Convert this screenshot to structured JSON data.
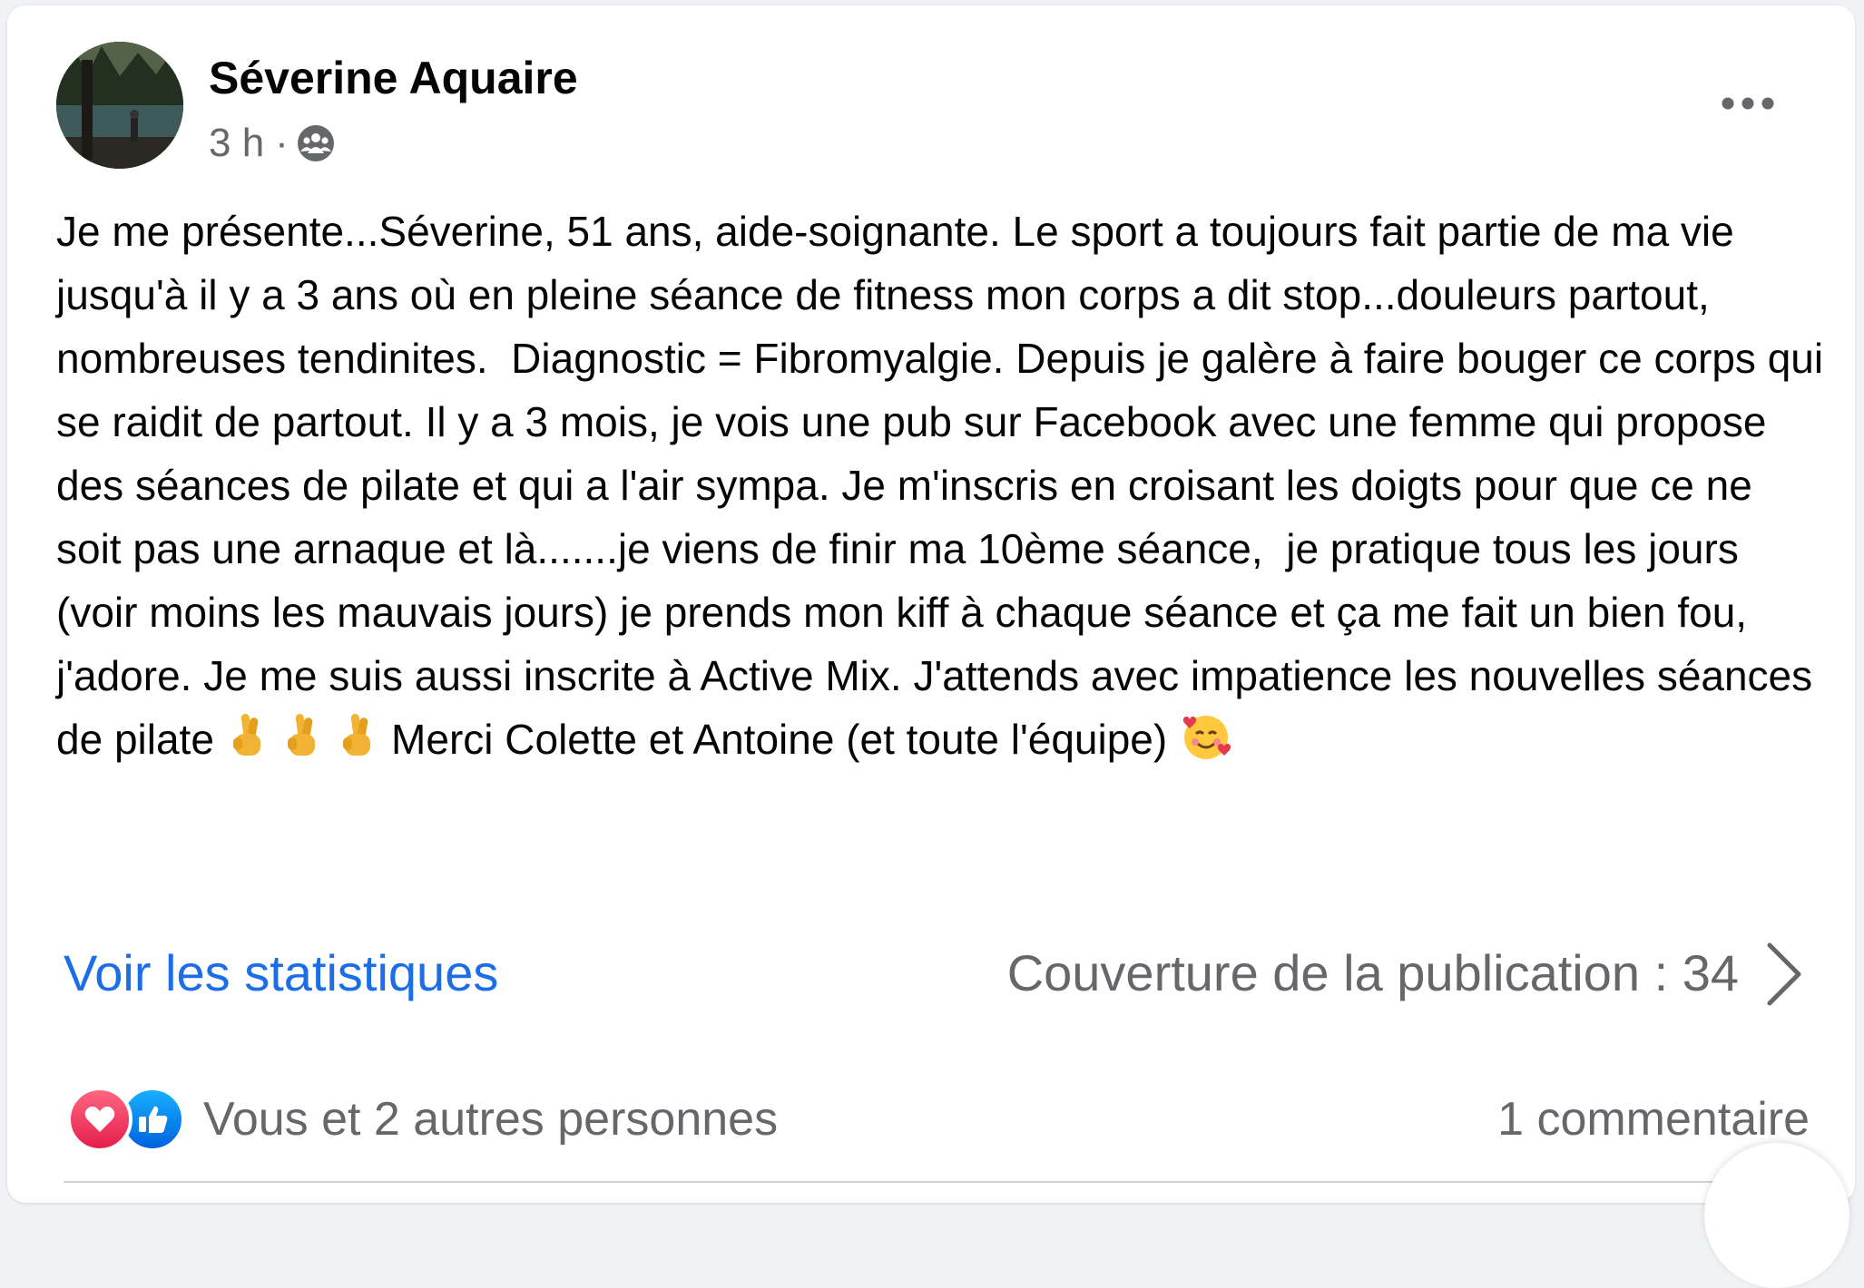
{
  "post": {
    "author": "Séverine Aquaire",
    "time": "3 h",
    "separator": "·",
    "audience_icon": "group-icon",
    "more_icon": "more-horizontal-icon",
    "paragraph": {
      "text1": "Je me présente...Séverine, 51 ans, aide-soignante. Le sport a toujours fait partie de ma vie jusqu'à il y a 3 ans où en pleine séance de fitness mon corps a dit stop...douleurs partout, nombreuses tendinites.  Diagnostic = Fibromyalgie. Depuis je galère à faire bouger ce corps qui se raidit de partout. Il y a 3 mois, je vois une pub sur Facebook avec une femme qui propose des séances de pilate et qui a l'air sympa. Je m'inscris en croisant les doigts pour que ce ne soit pas une arnaque et là.......je viens de finir ma 10ème séance,  je pratique tous les jours (voir moins les mauvais jours) je prends mon kiff à chaque séance et ça me fait un bien fou, j'adore. Je me suis aussi inscrite à Active Mix. J'attends avec impatience les nouvelles séances de pilate ",
      "text2": " Merci Colette et Antoine (et toute l'équipe) ",
      "emojis": [
        "crossed-fingers-emoji",
        "crossed-fingers-emoji",
        "crossed-fingers-emoji",
        "smiling-face-with-hearts-emoji"
      ]
    },
    "stats_link": "Voir les statistiques",
    "reach_label": "Couverture de la publication : 34",
    "reactions_text": "Vous et 2 autres personnes",
    "reaction_icons": [
      "love-icon",
      "like-icon"
    ],
    "comments_label": "1 commentaire"
  },
  "colors": {
    "link_blue": "#1b6ee8",
    "secondary_text": "#65676b",
    "love": "#e61e4d",
    "like": "#0062df"
  }
}
